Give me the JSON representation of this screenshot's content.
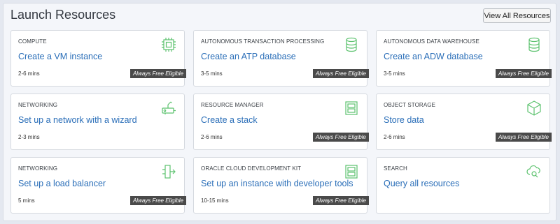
{
  "panel": {
    "title": "Launch Resources",
    "view_all_label": "View All Resources"
  },
  "free_badge_label": "Always Free Eligible",
  "accent_color": "#2a6eb8",
  "icon_color": "#5cc26e",
  "cards": [
    {
      "category": "COMPUTE",
      "link": "Create a VM instance",
      "time": "2-6 mins",
      "free": true,
      "icon": "chip-icon"
    },
    {
      "category": "AUTONOMOUS TRANSACTION PROCESSING",
      "link": "Create an ATP database",
      "time": "3-5 mins",
      "free": true,
      "icon": "database-icon"
    },
    {
      "category": "AUTONOMOUS DATA WAREHOUSE",
      "link": "Create an ADW database",
      "time": "3-5 mins",
      "free": true,
      "icon": "database-icon"
    },
    {
      "category": "NETWORKING",
      "link": "Set up a network with a wizard",
      "time": "2-3 mins",
      "free": false,
      "icon": "network-wizard-icon"
    },
    {
      "category": "RESOURCE MANAGER",
      "link": "Create a stack",
      "time": "2-6 mins",
      "free": true,
      "icon": "stack-icon"
    },
    {
      "category": "OBJECT STORAGE",
      "link": "Store data",
      "time": "2-6 mins",
      "free": true,
      "icon": "box-icon"
    },
    {
      "category": "NETWORKING",
      "link": "Set up a load balancer",
      "time": "5 mins",
      "free": true,
      "icon": "load-balancer-icon"
    },
    {
      "category": "ORACLE CLOUD DEVELOPMENT KIT",
      "link": "Set up an instance with developer tools",
      "time": "10-15 mins",
      "free": true,
      "icon": "stack-icon"
    },
    {
      "category": "SEARCH",
      "link": "Query all resources",
      "time": "",
      "free": false,
      "icon": "cloud-search-icon"
    }
  ]
}
